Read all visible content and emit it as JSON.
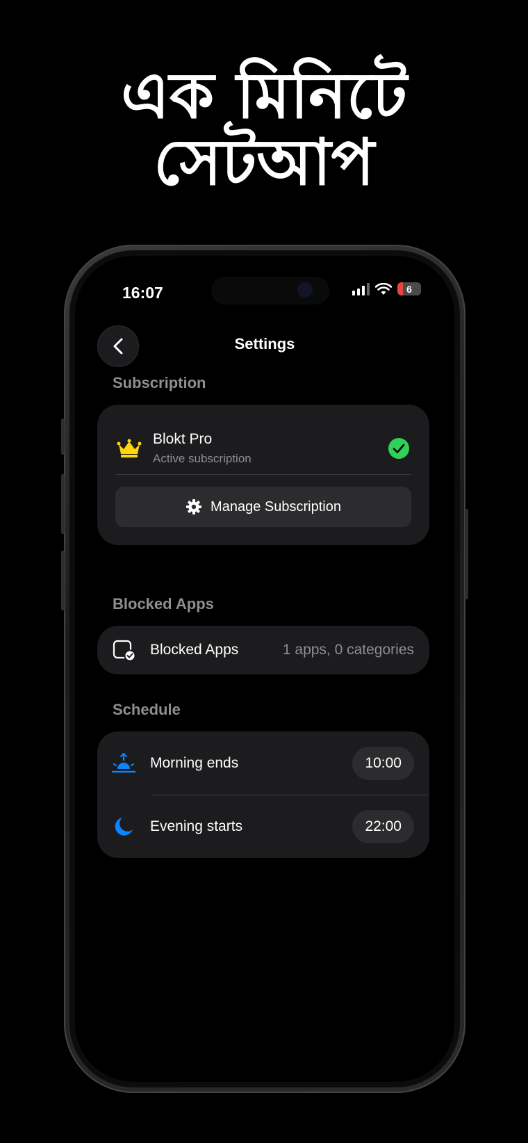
{
  "promo": {
    "headline_line1": "এক মিনিটে",
    "headline_line2": "সেটআপ"
  },
  "status_bar": {
    "time": "16:07",
    "battery": "6"
  },
  "nav": {
    "title": "Settings"
  },
  "subscription": {
    "section_label": "Subscription",
    "plan_name": "Blokt Pro",
    "plan_status": "Active subscription",
    "manage_label": "Manage Subscription"
  },
  "blocked_apps": {
    "section_label": "Blocked Apps",
    "row_label": "Blocked Apps",
    "row_value": "1 apps, 0 categories"
  },
  "schedule": {
    "section_label": "Schedule",
    "items": [
      {
        "label": "Morning ends",
        "time": "10:00",
        "icon": "sunrise-icon"
      },
      {
        "label": "Evening starts",
        "time": "22:00",
        "icon": "moon-icon"
      }
    ]
  },
  "colors": {
    "background": "#000000",
    "card": "#1c1c1e",
    "accent_blue": "#0a84ff",
    "crown_yellow": "#ffd60a",
    "check_green": "#30d158",
    "secondary_text": "#8e8e93"
  }
}
